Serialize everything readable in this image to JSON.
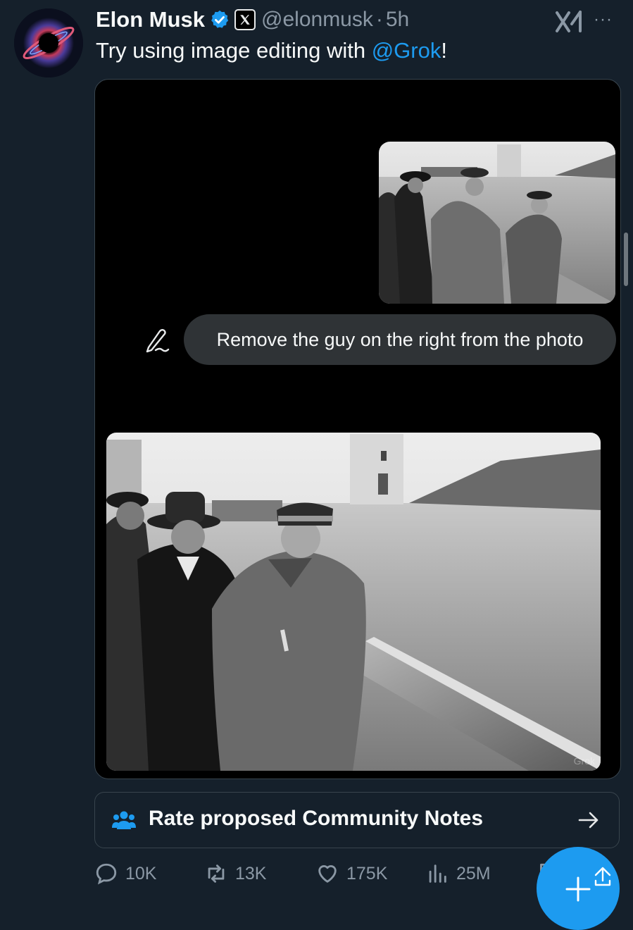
{
  "post": {
    "author_name": "Elon Musk",
    "handle": "@elonmusk",
    "separator": "·",
    "time": "5h",
    "text_prefix": "Try using image editing with ",
    "mention": "@Grok",
    "text_suffix": "!",
    "more_label": "···"
  },
  "media": {
    "prompt": "Remove the guy on the right from the photo",
    "watermark": "Grok"
  },
  "community_notes": {
    "label": "Rate proposed Community Notes"
  },
  "actions": {
    "replies": "10K",
    "reposts": "13K",
    "likes": "175K",
    "views": "25M"
  },
  "colors": {
    "background": "#15202b",
    "accent": "#1d9bf0",
    "secondary_text": "#8b98a5"
  },
  "icons": [
    "verified-badge-icon",
    "x-affiliate-badge-icon",
    "xai-logo-icon",
    "more-icon",
    "edit-pen-icon",
    "community-people-icon",
    "arrow-right-icon",
    "reply-icon",
    "repost-icon",
    "like-icon",
    "views-icon",
    "bookmark-icon",
    "share-icon",
    "compose-plus-icon"
  ]
}
